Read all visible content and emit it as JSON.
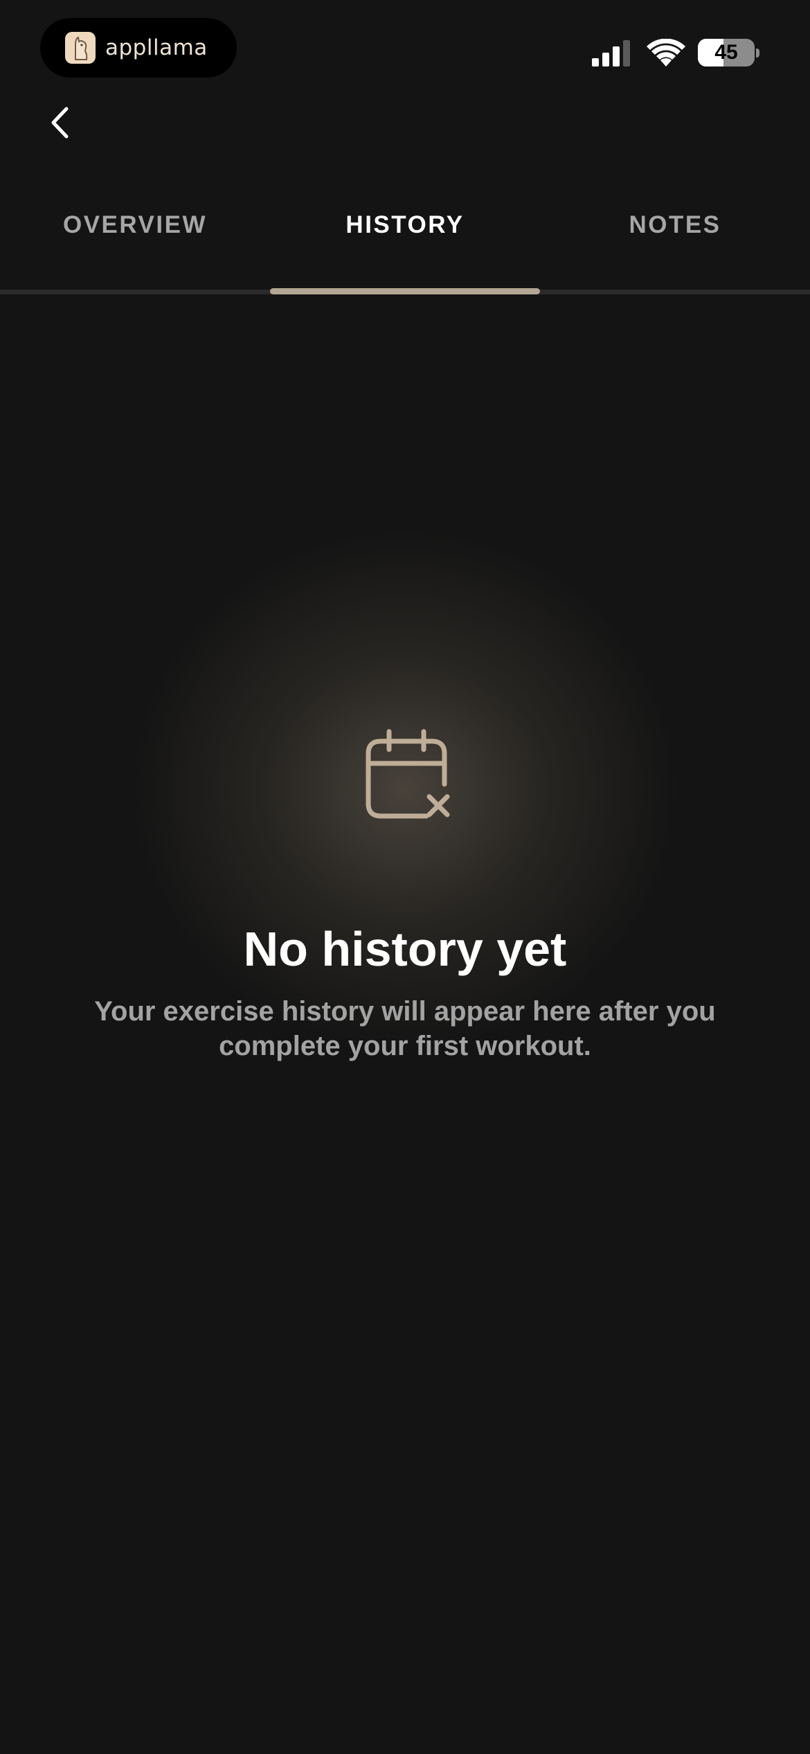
{
  "status_bar": {
    "app_name": "appllama",
    "battery_percent": "45",
    "battery_level": 0.45,
    "signal_icon": "cellular-signal-icon",
    "wifi_icon": "wifi-icon"
  },
  "nav": {
    "back_icon": "chevron-left-icon"
  },
  "tabs": [
    {
      "label": "OVERVIEW",
      "active": false
    },
    {
      "label": "HISTORY",
      "active": true
    },
    {
      "label": "NOTES",
      "active": false
    }
  ],
  "empty_state": {
    "icon": "calendar-x-icon",
    "title": "No history yet",
    "message": "Your exercise history will appear here after you complete your first workout."
  },
  "colors": {
    "background": "#141414",
    "accent": "#b3a694",
    "icon_tan": "#bfae97"
  }
}
